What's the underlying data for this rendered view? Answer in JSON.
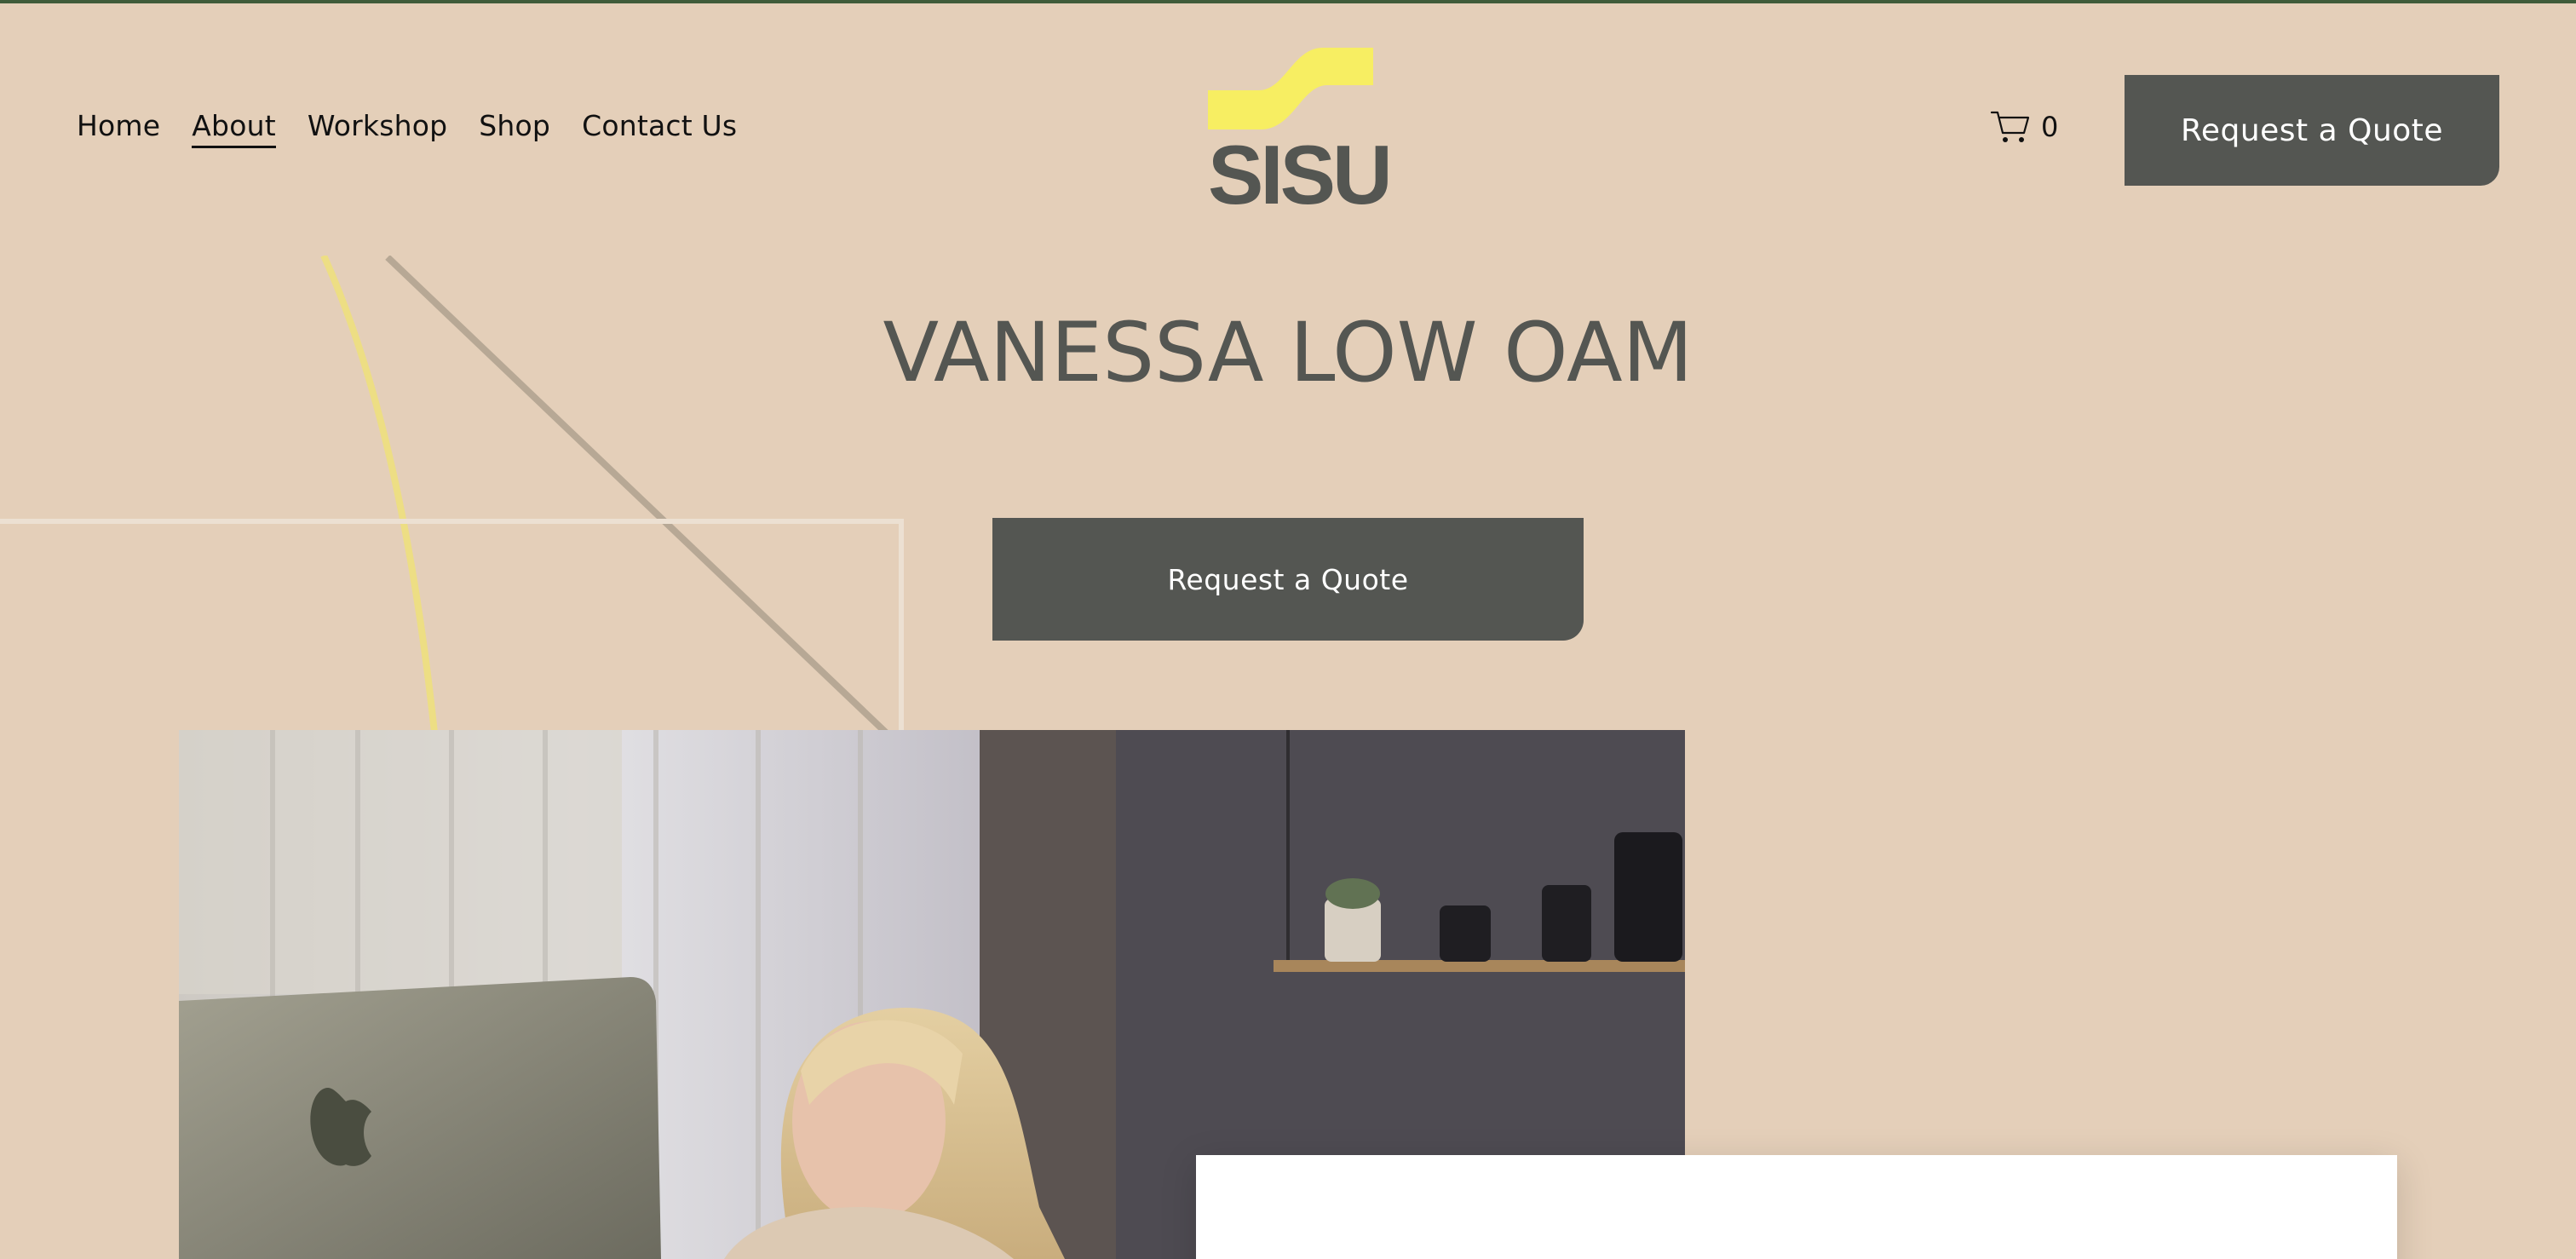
{
  "header": {
    "nav": [
      {
        "label": "Home",
        "active": false
      },
      {
        "label": "About",
        "active": true
      },
      {
        "label": "Workshop",
        "active": false
      },
      {
        "label": "Shop",
        "active": false
      },
      {
        "label": "Contact Us",
        "active": false
      }
    ],
    "logo_text": "SISU",
    "cart_icon": "cart-icon",
    "cart_count": "0",
    "cta_label": "Request a Quote"
  },
  "hero": {
    "title": "VANESSA LOW OAM",
    "cta_label": "Request a Quote"
  },
  "colors": {
    "background": "#e4cfb9",
    "button": "#545652",
    "logo_yellow": "#f7ee62",
    "logo_grey": "#545652",
    "top_line": "#3f5c3a"
  }
}
